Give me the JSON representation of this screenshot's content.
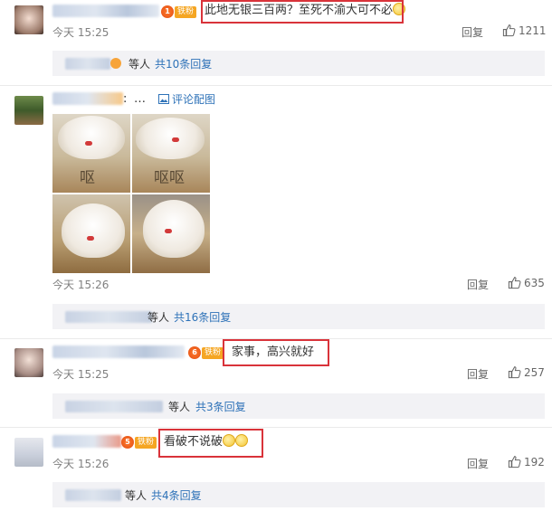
{
  "comments": [
    {
      "text": "此地无银三百两？至死不渝大可不必",
      "badge_level": "1",
      "badge_label": "铁粉",
      "time": "今天 15:25",
      "reply_label": "回复",
      "likes": "1211",
      "sub": {
        "deng": "等人",
        "gong": "共10条回复"
      }
    },
    {
      "separator": ":",
      "ellipsis": "…",
      "pic_link": "评论配图",
      "image_caption_1": "呕",
      "image_caption_2": "呕呕",
      "time": "今天 15:26",
      "reply_label": "回复",
      "likes": "635",
      "sub": {
        "deng": "等人",
        "gong": "共16条回复"
      }
    },
    {
      "text": "家事，高兴就好",
      "badge_level": "6",
      "badge_label": "铁粉",
      "time": "今天 15:25",
      "reply_label": "回复",
      "likes": "257",
      "sub": {
        "deng": "等人",
        "gong": "共3条回复"
      }
    },
    {
      "text": "看破不说破",
      "badge_level": "5",
      "badge_label": "铁粉",
      "time": "今天 15:26",
      "reply_label": "回复",
      "likes": "192",
      "sub": {
        "deng": "等人",
        "gong": "共4条回复"
      }
    }
  ],
  "colors": {
    "highlight": "#d9333a",
    "link": "#2e72b8",
    "fan_badge": "#f5a623"
  },
  "icons": [
    "like-thumb-icon",
    "image-icon",
    "v-badge-icon",
    "emoji-icon"
  ]
}
